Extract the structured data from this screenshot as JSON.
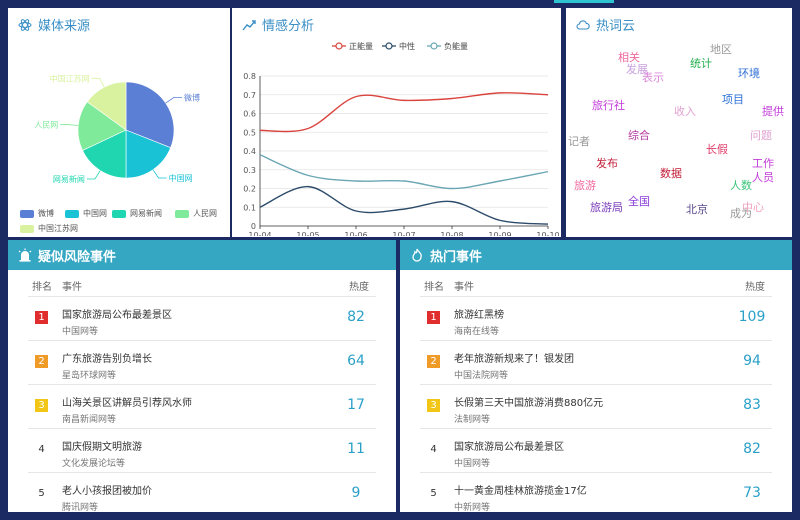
{
  "media": {
    "title": "媒体来源",
    "slices": [
      {
        "name": "微博",
        "value": 31,
        "color": "#5b7fd5"
      },
      {
        "name": "中国网",
        "value": 19,
        "color": "#1ac2d6"
      },
      {
        "name": "网易新闻",
        "value": 18,
        "color": "#1fd6b0"
      },
      {
        "name": "人民网",
        "value": 17,
        "color": "#7fea9a"
      },
      {
        "name": "中国江苏网",
        "value": 15,
        "color": "#d9f2a0"
      }
    ]
  },
  "sentiment": {
    "title": "情感分析",
    "chart_data": {
      "type": "line",
      "x": [
        "10-04",
        "10-05",
        "10-06",
        "10-07",
        "10-08",
        "10-09",
        "10-10"
      ],
      "ylim": [
        0,
        0.8
      ],
      "yticks": [
        "0",
        "0.1",
        "0.2",
        "0.3",
        "0.4",
        "0.5",
        "0.6",
        "0.7",
        "0.8"
      ],
      "series": [
        {
          "name": "正能量",
          "color": "#d9443d",
          "values": [
            0.51,
            0.52,
            0.69,
            0.67,
            0.68,
            0.71,
            0.7
          ]
        },
        {
          "name": "中性",
          "color": "#2c4b6a",
          "values": [
            0.1,
            0.21,
            0.08,
            0.09,
            0.13,
            0.03,
            0.01
          ]
        },
        {
          "name": "负能量",
          "color": "#6aa6b3",
          "values": [
            0.38,
            0.27,
            0.24,
            0.24,
            0.2,
            0.24,
            0.29
          ]
        }
      ]
    }
  },
  "cloud": {
    "title": "热词云",
    "words": [
      {
        "t": "地区",
        "c": "#999999",
        "s": 11
      },
      {
        "t": "相关",
        "c": "#f06a9e",
        "s": 11
      },
      {
        "t": "发展",
        "c": "#c9a0e0",
        "s": 11
      },
      {
        "t": "统计",
        "c": "#23b04d",
        "s": 11
      },
      {
        "t": "表示",
        "c": "#d889d9",
        "s": 11
      },
      {
        "t": "环境",
        "c": "#2d6fd6",
        "s": 11
      },
      {
        "t": "项目",
        "c": "#2d6fd6",
        "s": 11
      },
      {
        "t": "旅行社",
        "c": "#c23bd9",
        "s": 11
      },
      {
        "t": "收入",
        "c": "#e0a0d0",
        "s": 11
      },
      {
        "t": "提供",
        "c": "#c23bd9",
        "s": 11
      },
      {
        "t": "综合",
        "c": "#b3399e",
        "s": 11
      },
      {
        "t": "长假",
        "c": "#e03c6a",
        "s": 11
      },
      {
        "t": "发布",
        "c": "#c21f3a",
        "s": 11
      },
      {
        "t": "工作",
        "c": "#c23bd9",
        "s": 11
      },
      {
        "t": "人员",
        "c": "#c23bd9",
        "s": 11
      },
      {
        "t": "数据",
        "c": "#c21f3a",
        "s": 11
      },
      {
        "t": "人数",
        "c": "#3cc47a",
        "s": 11
      },
      {
        "t": "旅游",
        "c": "#f06a9e",
        "s": 11
      },
      {
        "t": "全国",
        "c": "#8a3bd9",
        "s": 11
      },
      {
        "t": "旅游局",
        "c": "#7a3bb9",
        "s": 11
      },
      {
        "t": "北京",
        "c": "#5a4a8a",
        "s": 11
      },
      {
        "t": "成为",
        "c": "#999999",
        "s": 11
      },
      {
        "t": "问题",
        "c": "#e0a0d0",
        "s": 11
      },
      {
        "t": "记者",
        "c": "#999999",
        "s": 11
      },
      {
        "t": "中心",
        "c": "#f0a0c0",
        "s": 11
      }
    ]
  },
  "risk": {
    "title": "疑似风险事件",
    "col_rank": "排名",
    "col_event": "事件",
    "col_heat": "热度",
    "rows": [
      {
        "rank": "1",
        "event": "国家旅游局公布最差景区",
        "source": "中国网等",
        "heat": "82"
      },
      {
        "rank": "2",
        "event": "广东旅游告别负增长",
        "source": "星岛环球网等",
        "heat": "64"
      },
      {
        "rank": "3",
        "event": "山海关景区讲解员引荐风水师",
        "source": "南昌新闻网等",
        "heat": "17"
      },
      {
        "rank": "4",
        "event": "国庆假期文明旅游",
        "source": "文化发展论坛等",
        "heat": "11"
      },
      {
        "rank": "5",
        "event": "老人小孩报团被加价",
        "source": "腾讯网等",
        "heat": "9"
      }
    ]
  },
  "hot": {
    "title": "热门事件",
    "col_rank": "排名",
    "col_event": "事件",
    "col_heat": "热度",
    "rows": [
      {
        "rank": "1",
        "event": "旅游红黑榜",
        "source": "海南在线等",
        "heat": "109"
      },
      {
        "rank": "2",
        "event": "老年旅游新规来了！银发团",
        "source": "中国法院网等",
        "heat": "94"
      },
      {
        "rank": "3",
        "event": "长假第三天中国旅游消费880亿元",
        "source": "法制网等",
        "heat": "83"
      },
      {
        "rank": "4",
        "event": "国家旅游局公布最差景区",
        "source": "中国网等",
        "heat": "82"
      },
      {
        "rank": "5",
        "event": "十一黄金周桂林旅游揽金17亿",
        "source": "中新网等",
        "heat": "73"
      }
    ]
  }
}
